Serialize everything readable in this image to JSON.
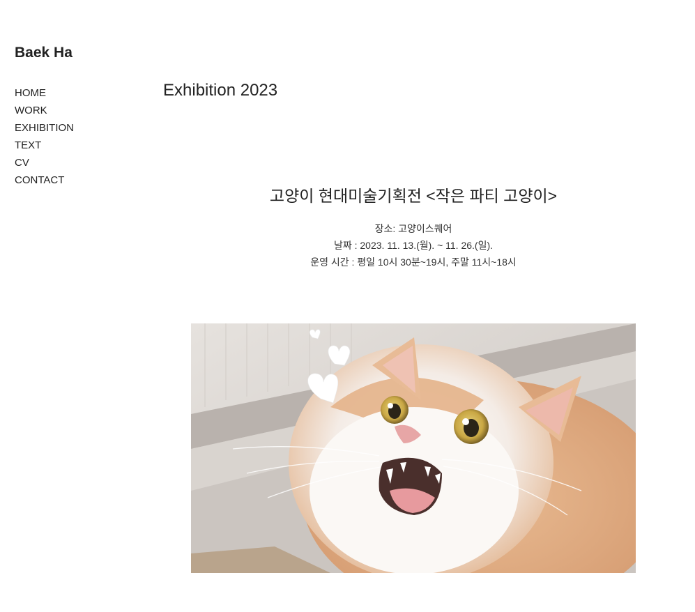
{
  "site": {
    "title": "Baek Ha"
  },
  "nav": {
    "items": [
      {
        "label": "HOME"
      },
      {
        "label": "WORK"
      },
      {
        "label": "EXHIBITION"
      },
      {
        "label": "TEXT"
      },
      {
        "label": "CV"
      },
      {
        "label": "CONTACT"
      }
    ]
  },
  "main": {
    "page_title": "Exhibition 2023",
    "exhibition": {
      "title": "고양이 현대미술기획전 <작은 파티 고양이>",
      "venue": "장소: 고양이스퀘어",
      "date": "날짜 : 2023. 11. 13.(월). ~ 11. 26.(일).",
      "hours": "운영 시간 : 평일 10시 30분~19시, 주말 11시~18시"
    },
    "image": {
      "subject": "cat-photo"
    }
  }
}
